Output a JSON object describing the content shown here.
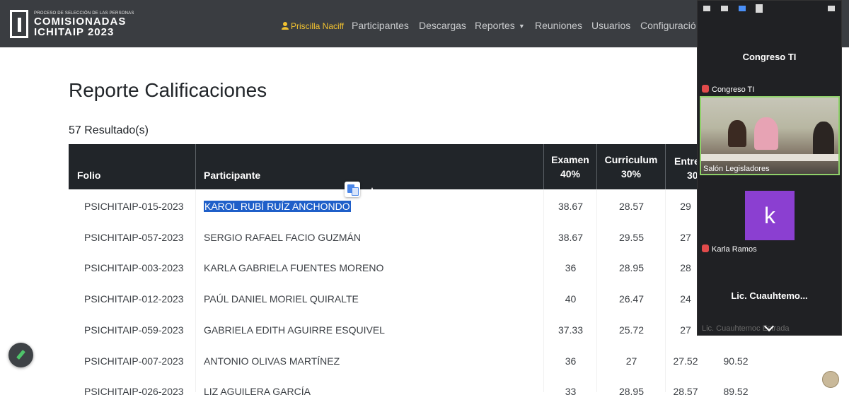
{
  "app": {
    "logo_small": "PROCESO DE SELECCIÓN DE LAS PERSONAS",
    "logo_line1": "COMISIONADAS",
    "logo_line2": "ICHITAIP 2023"
  },
  "nav": {
    "user": "Priscilla Naciff",
    "items": [
      "Participantes",
      "Descargas",
      "Reportes",
      "Reuniones",
      "Usuarios",
      "Configuració"
    ]
  },
  "page": {
    "title": "Reporte Calificaciones",
    "results": "57 Resultado(s)"
  },
  "table": {
    "headers": {
      "folio": "Folio",
      "participante": "Participante",
      "examen_1": "Examen",
      "examen_2": "40%",
      "curriculum_1": "Curriculum",
      "curriculum_2": "30%",
      "entrevista_1": "Entre",
      "entrevista_2": "30"
    },
    "rows": [
      {
        "folio": "PSICHITAIP-015-2023",
        "nombre": "KAROL RUBÍ RUÍZ ANCHONDO",
        "examen": "38.67",
        "curriculum": "28.57",
        "entrevista": "29",
        "total": ""
      },
      {
        "folio": "PSICHITAIP-057-2023",
        "nombre": "SERGIO RAFAEL FACIO GUZMÁN",
        "examen": "38.67",
        "curriculum": "29.55",
        "entrevista": "27",
        "total": ""
      },
      {
        "folio": "PSICHITAIP-003-2023",
        "nombre": "KARLA GABRIELA FUENTES MORENO",
        "examen": "36",
        "curriculum": "28.95",
        "entrevista": "28",
        "total": ""
      },
      {
        "folio": "PSICHITAIP-012-2023",
        "nombre": "PAÚL DANIEL MORIEL QUIRALTE",
        "examen": "40",
        "curriculum": "26.47",
        "entrevista": "24",
        "total": ""
      },
      {
        "folio": "PSICHITAIP-059-2023",
        "nombre": "GABRIELA EDITH AGUIRRE ESQUIVEL",
        "examen": "37.33",
        "curriculum": "25.72",
        "entrevista": "27",
        "total": ""
      },
      {
        "folio": "PSICHITAIP-007-2023",
        "nombre": "ANTONIO OLIVAS MARTÍNEZ",
        "examen": "36",
        "curriculum": "27",
        "entrevista": "27.52",
        "total": "90.52"
      },
      {
        "folio": "PSICHITAIP-026-2023",
        "nombre": "LIZ AGUILERA GARCÍA",
        "examen": "33",
        "curriculum": "28.95",
        "entrevista": "28.57",
        "total": "89.52"
      }
    ]
  },
  "zoom": {
    "tile1_name": "Congreso TI",
    "tile1_tag": "Congreso TI",
    "video_tag": "Salón Legisladores",
    "avatar_letter": "k",
    "tile3_tag": "Karla Ramos",
    "tile4_name": "Lic.  Cuauhtemo...",
    "tile4_tag": "Lic. Cuauhtemoc Estrada",
    "avatar_color": "#8b3fd1"
  }
}
